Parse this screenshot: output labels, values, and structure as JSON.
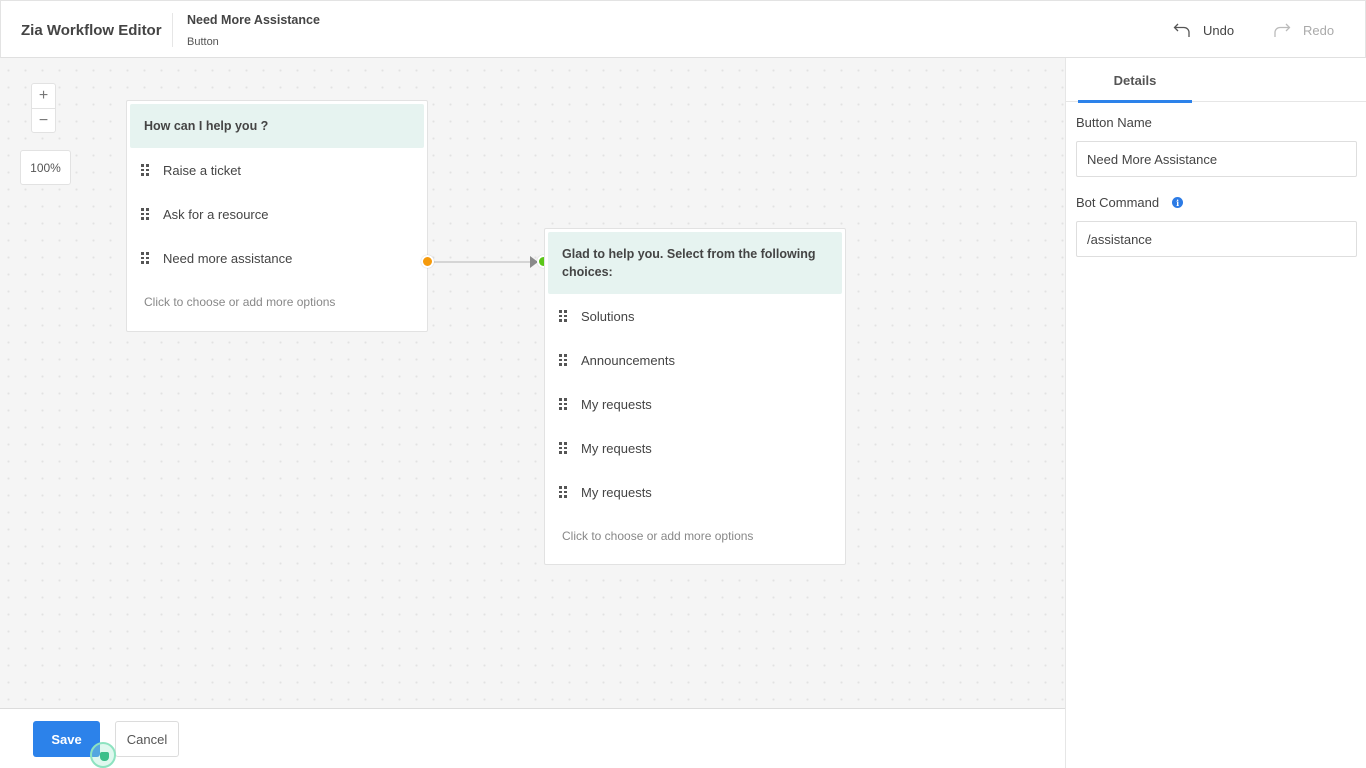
{
  "header": {
    "app_title": "Zia Workflow Editor",
    "node_title": "Need More Assistance",
    "node_type": "Button",
    "undo_label": "Undo",
    "redo_label": "Redo"
  },
  "canvas": {
    "zoom_in": "+",
    "zoom_out": "−",
    "zoom_level": "100%",
    "cards": [
      {
        "heading": "How can I help you ?",
        "options": [
          "Raise a ticket",
          "Ask for a resource",
          "Need more assistance"
        ],
        "add_option": "Click to choose or add more options"
      },
      {
        "heading": "Glad to help you. Select from the following choices:",
        "options": [
          "Solutions",
          "Announcements",
          "My requests",
          "My requests",
          "My requests"
        ],
        "add_option": "Click to choose or add more options"
      }
    ],
    "colors": {
      "out_port": "#f59a0c",
      "in_port": "#5ac618",
      "card_header": "#e6f3f0"
    }
  },
  "footer": {
    "save_label": "Save",
    "cancel_label": "Cancel"
  },
  "panel": {
    "tabs": [
      {
        "label": "Details",
        "active": true
      }
    ],
    "button_name_label": "Button Name",
    "button_name_value": "Need More Assistance",
    "bot_command_label": "Bot Command",
    "bot_command_value": "/assistance",
    "info_icon": "i",
    "accent_color": "#2c82ea"
  }
}
